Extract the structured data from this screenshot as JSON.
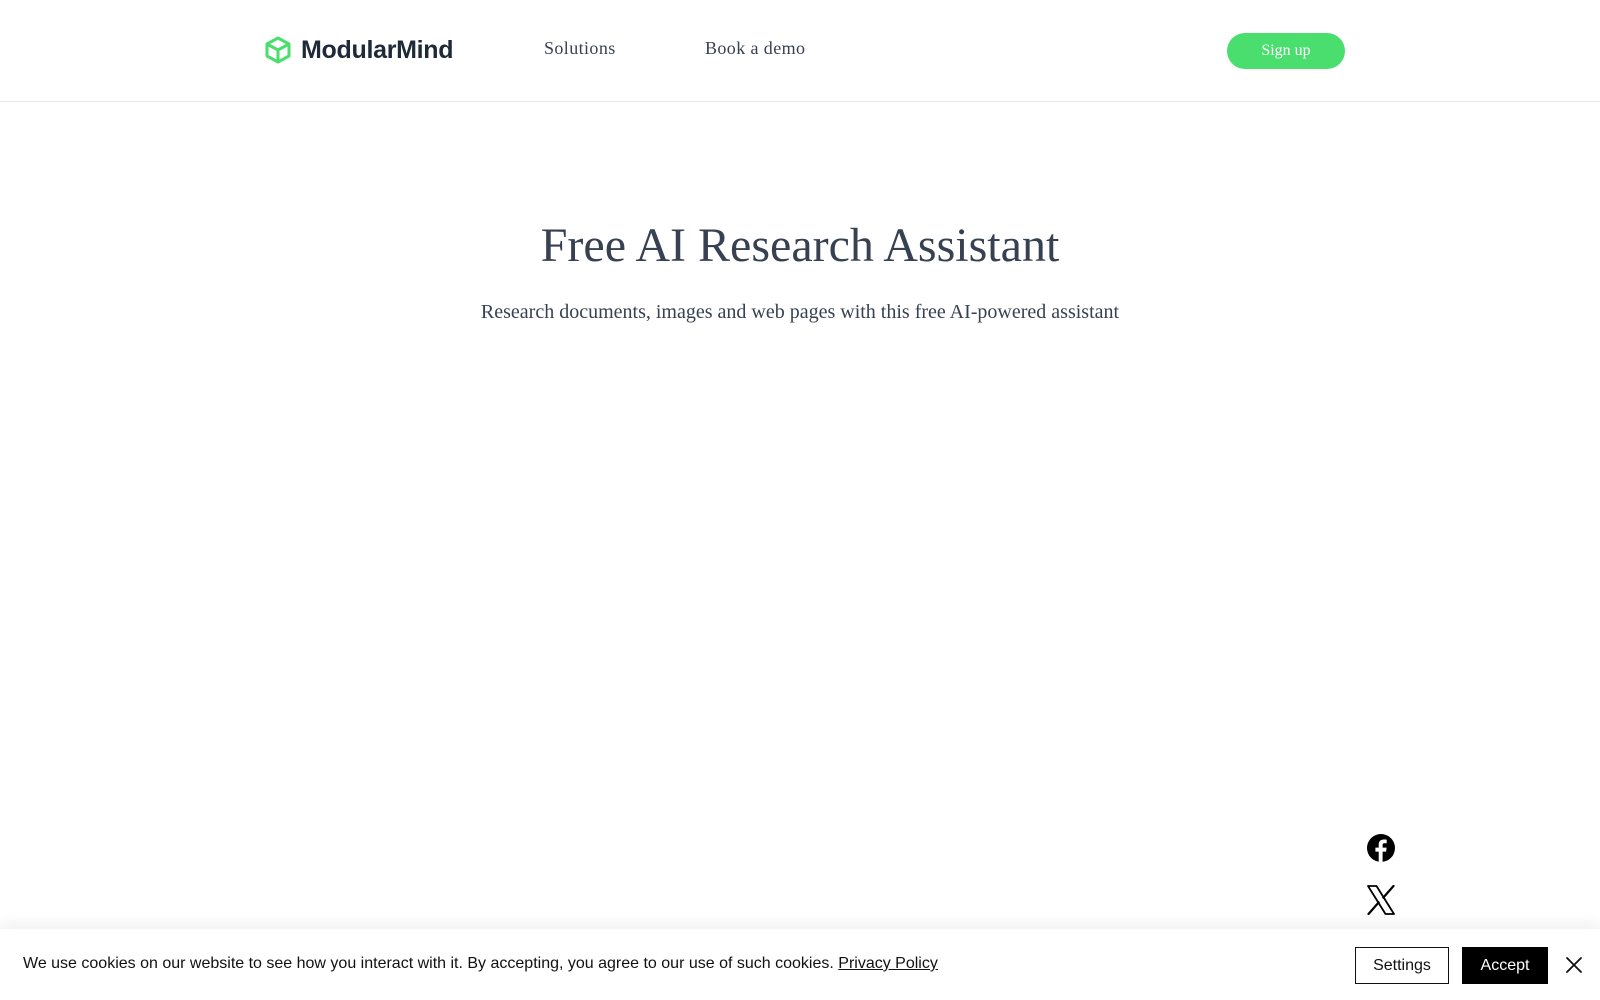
{
  "header": {
    "brand": "ModularMind",
    "nav": {
      "solutions": "Solutions",
      "book_demo": "Book a demo"
    },
    "signup_label": "Sign up"
  },
  "hero": {
    "title": "Free AI Research Assistant",
    "subtitle": "Research documents, images and web pages with this free AI-powered assistant"
  },
  "social": {
    "icons": [
      "facebook-icon",
      "x-twitter-icon"
    ]
  },
  "cookie_banner": {
    "message": "We use cookies on our website to see how you interact with it. By accepting, you agree to our use of such cookies.",
    "privacy_link": "Privacy Policy",
    "settings_label": "Settings",
    "accept_label": "Accept",
    "close_icon": "close-icon"
  },
  "colors": {
    "accent": "#4ade6e",
    "text_dark": "#374151",
    "brand_text": "#1f2937",
    "accept_bg": "#000000"
  }
}
